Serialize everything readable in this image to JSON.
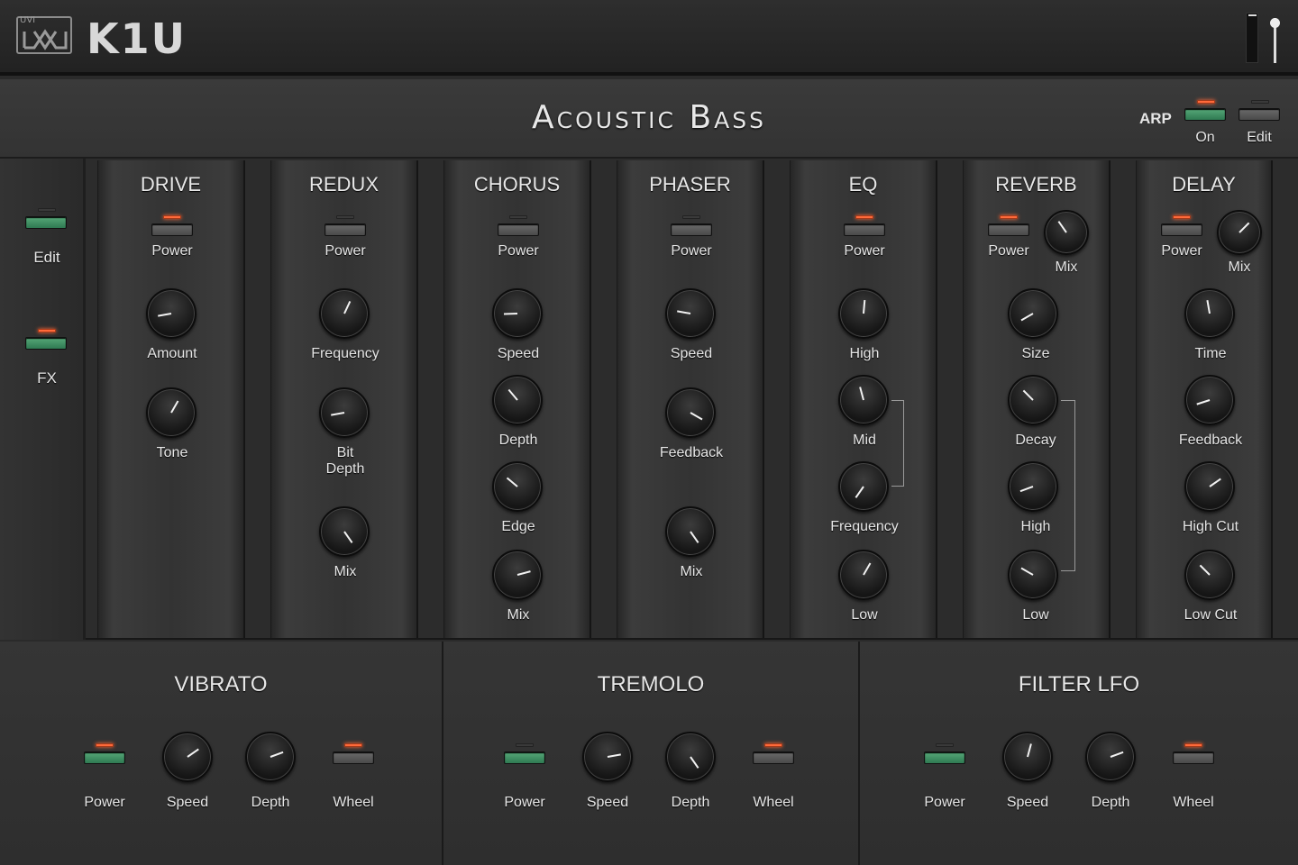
{
  "header": {
    "brand": "UVI",
    "app_name": "K1U"
  },
  "program": {
    "name": "Acoustic Bass",
    "arp_label": "ARP",
    "arp_on_label": "On",
    "arp_edit_label": "Edit"
  },
  "sidebar": {
    "edit_label": "Edit",
    "fx_label": "FX"
  },
  "fx": {
    "drive": {
      "title": "DRIVE",
      "power": "Power",
      "amount": "Amount",
      "tone": "Tone"
    },
    "redux": {
      "title": "REDUX",
      "power": "Power",
      "frequency": "Frequency",
      "bit_depth_1": "Bit",
      "bit_depth_2": "Depth",
      "mix": "Mix"
    },
    "chorus": {
      "title": "CHORUS",
      "power": "Power",
      "speed": "Speed",
      "depth": "Depth",
      "edge": "Edge",
      "mix": "Mix"
    },
    "phaser": {
      "title": "PHASER",
      "power": "Power",
      "speed": "Speed",
      "feedback": "Feedback",
      "mix": "Mix"
    },
    "eq": {
      "title": "EQ",
      "power": "Power",
      "high": "High",
      "mid": "Mid",
      "frequency": "Frequency",
      "low": "Low"
    },
    "reverb": {
      "title": "REVERB",
      "power": "Power",
      "mix": "Mix",
      "size": "Size",
      "decay": "Decay",
      "high": "High",
      "low": "Low"
    },
    "delay": {
      "title": "DELAY",
      "power": "Power",
      "mix": "Mix",
      "time": "Time",
      "feedback": "Feedback",
      "high_cut": "High Cut",
      "low_cut": "Low Cut"
    }
  },
  "lfo": {
    "vibrato": {
      "title": "VIBRATO",
      "power": "Power",
      "speed": "Speed",
      "depth": "Depth",
      "wheel": "Wheel"
    },
    "tremolo": {
      "title": "TREMOLO",
      "power": "Power",
      "speed": "Speed",
      "depth": "Depth",
      "wheel": "Wheel"
    },
    "filter_lfo": {
      "title": "FILTER LFO",
      "power": "Power",
      "speed": "Speed",
      "depth": "Depth",
      "wheel": "Wheel"
    }
  },
  "colors": {
    "led_on": "#ff6a3a",
    "button_green": "#3f8f62",
    "panel": "#333333"
  }
}
